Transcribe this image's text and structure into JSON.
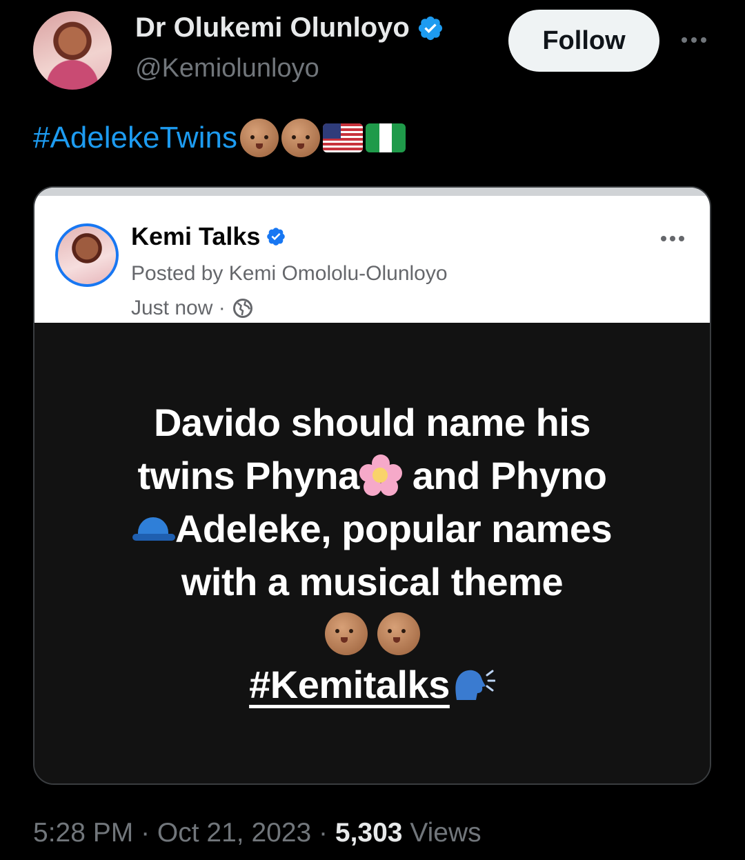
{
  "author": {
    "display_name": "Dr Olukemi Olunloyo",
    "handle": "@Kemiolunloyo",
    "follow_label": "Follow"
  },
  "tweet": {
    "hashtag": "#AdelekeTwins",
    "emojis": [
      "baby-icon",
      "baby-icon",
      "us-flag-icon",
      "nigeria-flag-icon"
    ]
  },
  "embedded_post": {
    "page_name": "Kemi Talks",
    "posted_by": "Posted by Kemi Omololu-Olunloyo",
    "time": "Just now ·",
    "line1": "Davido should name his",
    "line2a": "twins Phyna",
    "line2b": "and Phyno",
    "line3": "Adeleke, popular names",
    "line4": "with a musical theme",
    "hashtag": "#Kemitalks"
  },
  "meta": {
    "time": "5:28 PM · Oct 21, 2023 · ",
    "views_count": "5,303",
    "views_label": " Views"
  },
  "colors": {
    "link": "#1d9bf0",
    "verified": "#1d9bf0",
    "background": "#000000",
    "follow_bg": "#eff3f4"
  }
}
